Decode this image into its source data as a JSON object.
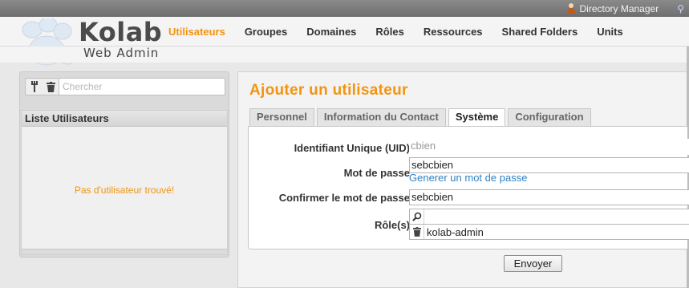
{
  "topbar": {
    "user_name": "Directory Manager",
    "user_icon": "user-icon",
    "extension_icon": "plugin-icon"
  },
  "brand": {
    "name": "Kolab",
    "subtitle": "Web Admin",
    "logo_icon": "paw-icon"
  },
  "nav": {
    "items": [
      {
        "label": "Utilisateurs",
        "active": true
      },
      {
        "label": "Groupes"
      },
      {
        "label": "Domaines"
      },
      {
        "label": "Rôles"
      },
      {
        "label": "Ressources"
      },
      {
        "label": "Shared Folders"
      },
      {
        "label": "Units"
      }
    ]
  },
  "sidebar": {
    "search_placeholder": "Chercher",
    "tool_icons": [
      "tools-icon",
      "trash-icon"
    ],
    "list_title": "Liste Utilisateurs",
    "empty_message": "Pas d'utilisateur trouvé!"
  },
  "main": {
    "title": "Ajouter un utilisateur",
    "tabs": [
      {
        "label": "Personnel"
      },
      {
        "label": "Information du Contact"
      },
      {
        "label": "Système",
        "active": true
      },
      {
        "label": "Configuration"
      }
    ],
    "form": {
      "uid_label": "Identifiant Unique (UID)",
      "uid_value": "cbien",
      "password_label": "Mot de passe",
      "password_value": "sebcbien",
      "generate_link": "Generer un mot de passe",
      "confirm_label": "Confirmer le mot de passe",
      "confirm_value": "sebcbien",
      "roles_label": "Rôle(s)",
      "roles_search_value": "",
      "roles": [
        "kolab-admin"
      ]
    },
    "submit_label": "Envoyer"
  },
  "colors": {
    "accent": "#f29410",
    "link": "#2f82c4",
    "topbar": "#777777"
  }
}
